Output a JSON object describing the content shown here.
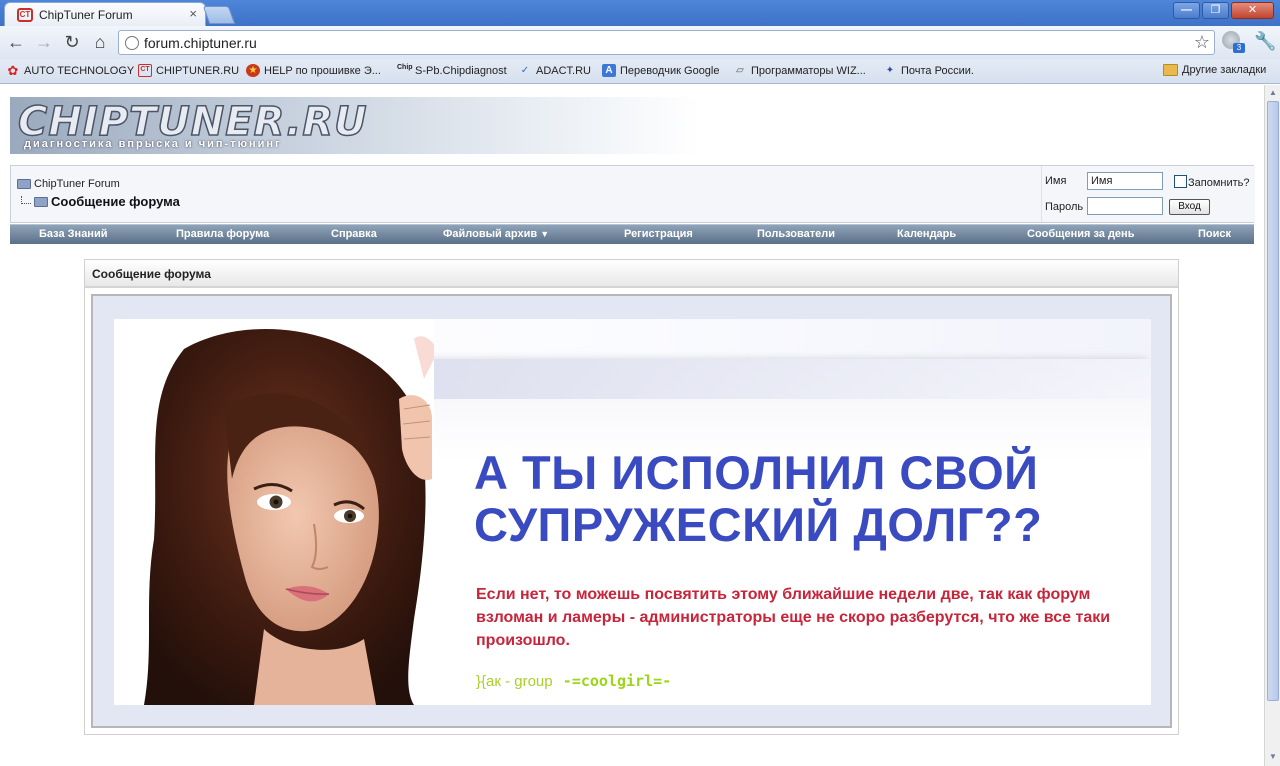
{
  "browser": {
    "tab_title": "ChipTuner Forum",
    "tab_favicon": "CT",
    "url": "forum.chiptuner.ru",
    "ext_badge": "3",
    "window_buttons": {
      "minimize": "—",
      "maximize": "❐",
      "close": "✕"
    }
  },
  "bookmarks": [
    {
      "label": "AUTO TECHNOLOGY",
      "icon": "flower-icon",
      "color": "#d22"
    },
    {
      "label": "CHIPTUNER.RU",
      "icon": "ct-icon",
      "color": "#c9302c"
    },
    {
      "label": "HELP по прошивке Э...",
      "icon": "star-badge-icon",
      "color": "#c83a1a"
    },
    {
      "label": "S-Pb.Chipdiagnost",
      "icon": "chip-icon",
      "color": "#333"
    },
    {
      "label": "ADACT.RU",
      "icon": "check-icon",
      "color": "#2a6fc9"
    },
    {
      "label": "Переводчик Google",
      "icon": "translate-icon",
      "color": "#3b78d8"
    },
    {
      "label": "Программаторы WIZ...",
      "icon": "programmer-icon",
      "color": "#666"
    },
    {
      "label": "Почта России.",
      "icon": "eagle-icon",
      "color": "#2b4fa3"
    }
  ],
  "other_bookmarks": "Другие закладки",
  "site": {
    "logo_text": "CHIPTUNER.RU",
    "logo_subtitle": "диагностика впрыска и чип-тюнинг"
  },
  "breadcrumb": {
    "root": "ChipTuner Forum",
    "current": "Сообщение форума"
  },
  "login": {
    "name_label": "Имя",
    "name_value": "Имя",
    "password_label": "Пароль",
    "password_value": "",
    "remember_label": "Запомнить?",
    "submit_label": "Вход"
  },
  "menu": [
    "База Знаний",
    "Правила форума",
    "Справка",
    "Файловый архив",
    "Регистрация",
    "Пользователи",
    "Календарь",
    "Сообщения за день",
    "Поиск"
  ],
  "message": {
    "title": "Сообщение форума",
    "headline_1": "А ТЫ ИСПОЛНИЛ СВОЙ",
    "headline_2": "СУПРУЖЕСКИЙ ДОЛГ??",
    "body": "Если нет, то можешь посвятить этому ближайшие недели две, так как форум взломан  и   ламеры - администраторы еще  не скоро разберутся,  что же все таки произошло.",
    "signature": "}{ак - group ",
    "signature_tag": "-=coolgirl=-"
  },
  "colors": {
    "headline": "#3a4ac0",
    "body_text": "#c8243a",
    "signature": "#a8cf2a"
  }
}
